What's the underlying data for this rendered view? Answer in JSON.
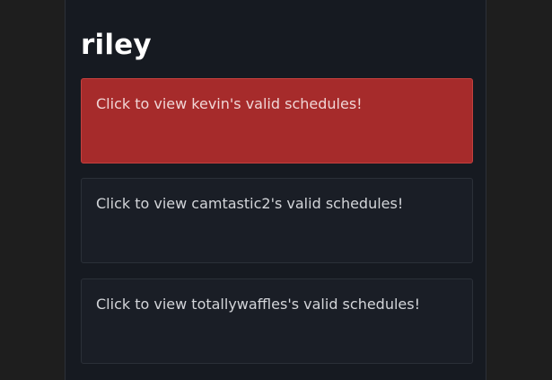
{
  "page": {
    "title": "riley"
  },
  "cards": [
    {
      "label": "Click to view kevin's valid schedules!",
      "state": "active"
    },
    {
      "label": "Click to view camtastic2's valid schedules!",
      "state": "default"
    },
    {
      "label": "Click to view totallywaffles's valid schedules!",
      "state": "default"
    }
  ],
  "colors": {
    "page_bg": "#1e1e1e",
    "panel_bg": "#161a21",
    "card_bg": "#1a1e26",
    "active_card_bg": "#a62b2b",
    "title_text": "#ffffff"
  }
}
